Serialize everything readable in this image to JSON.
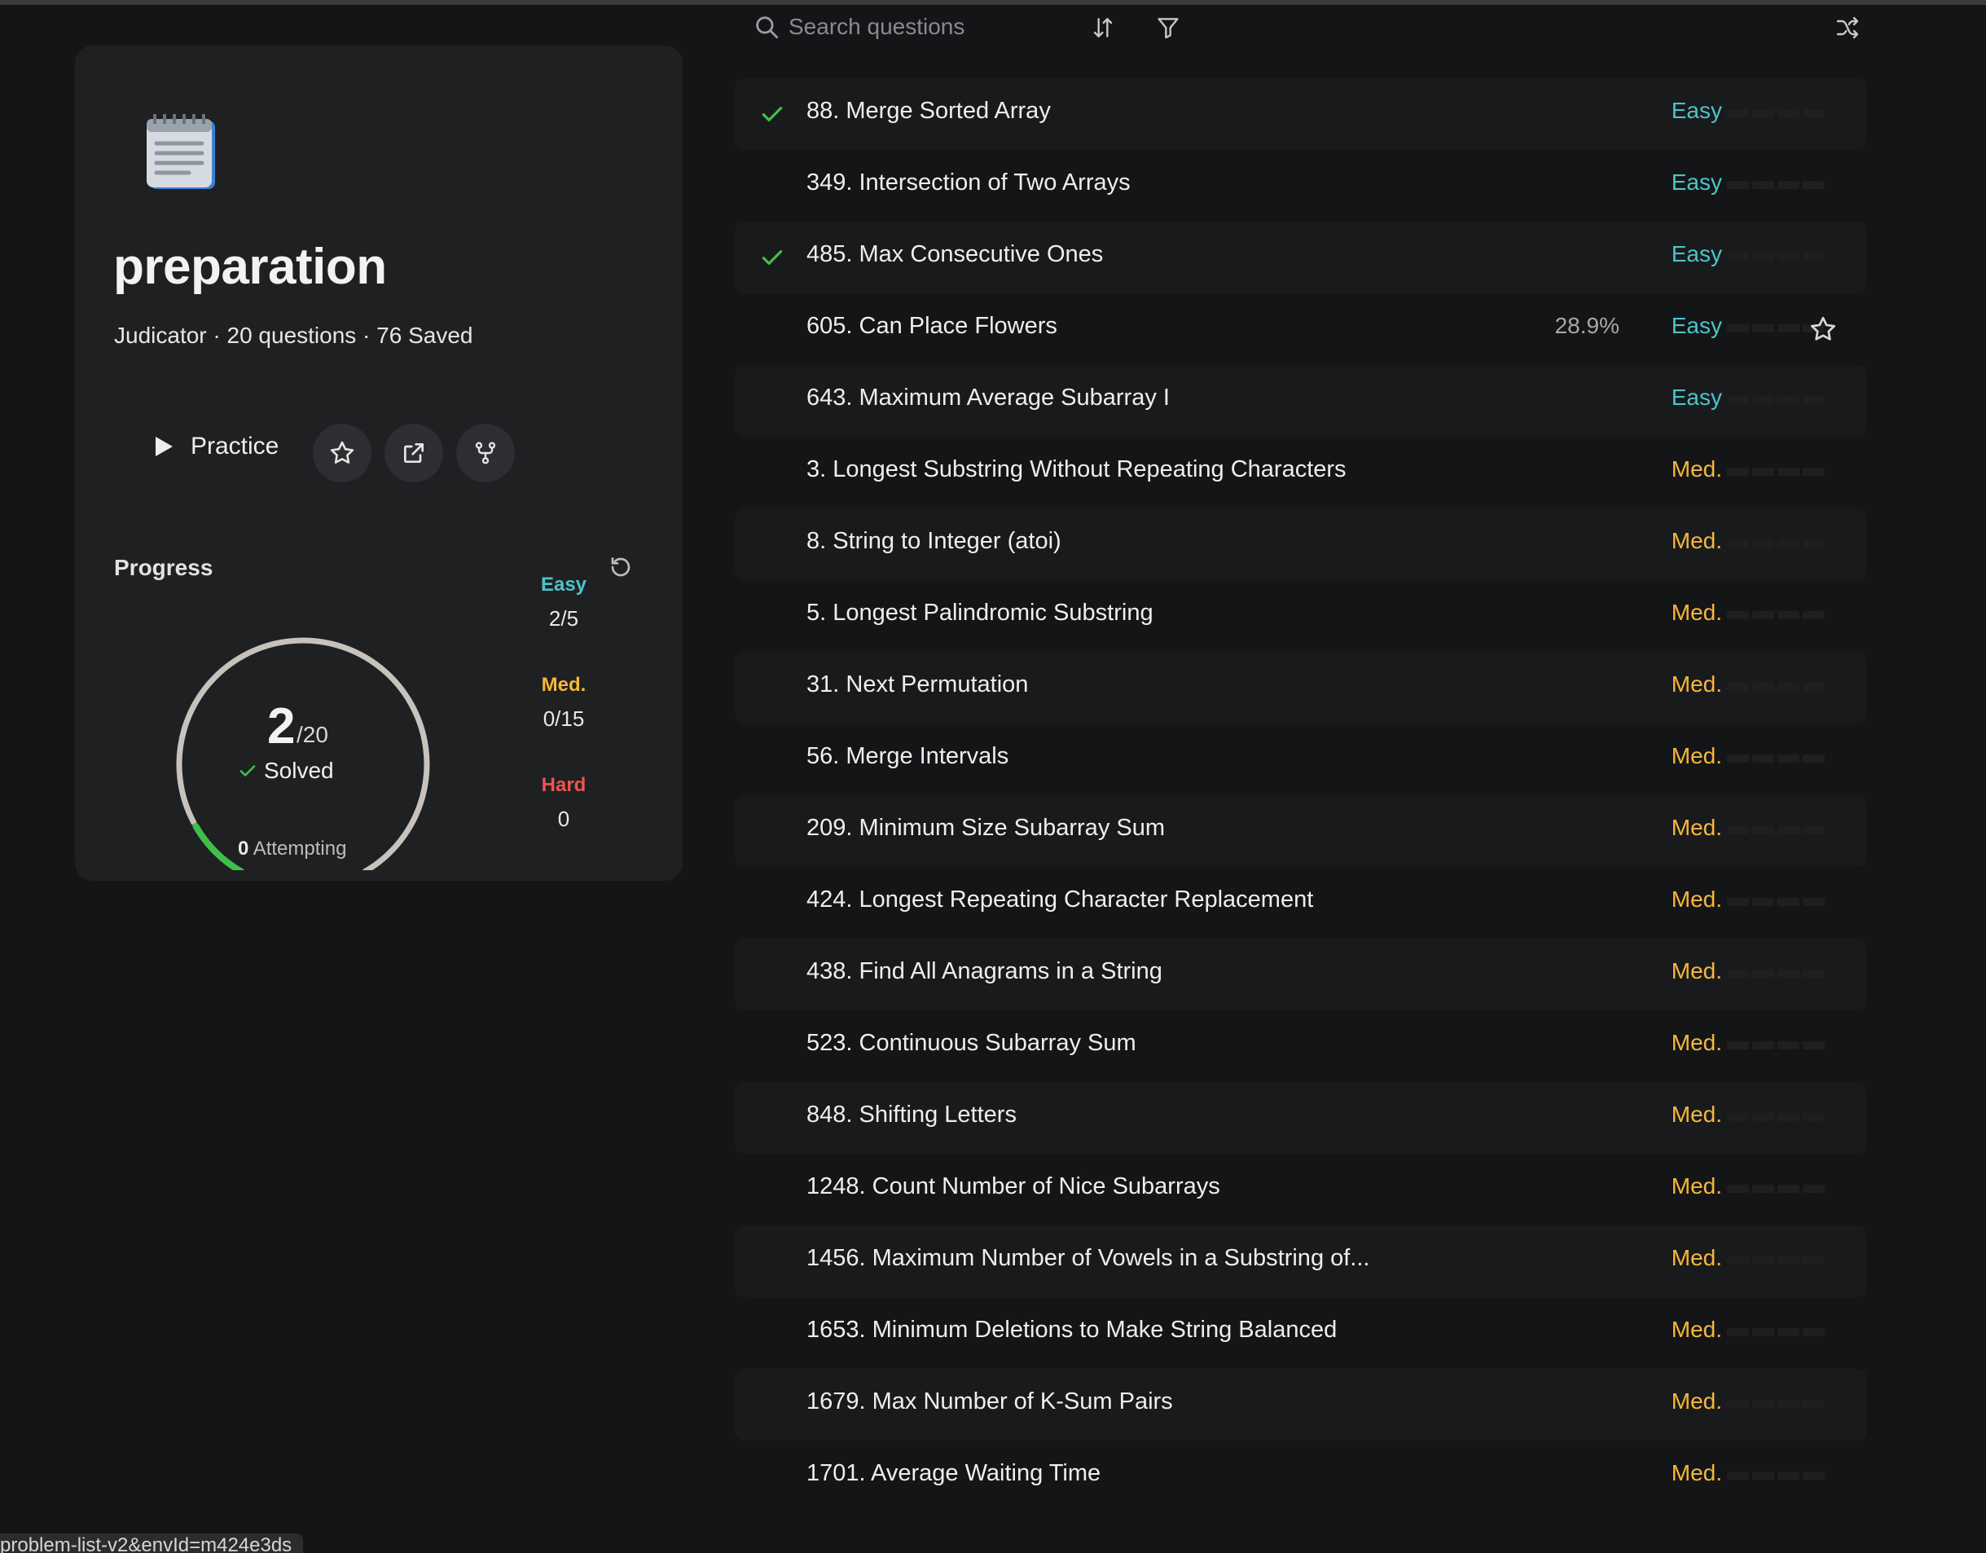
{
  "colors": {
    "easy": "#4dc3c8",
    "medium": "#f5b73b",
    "hard": "#ef5350",
    "solved_check": "#3ec14b",
    "progress_arc": "#3fbf4a"
  },
  "toolbar": {
    "search_placeholder": "Search questions",
    "icons": [
      "search-icon",
      "sort-icon",
      "filter-icon",
      "shuffle-icon"
    ]
  },
  "list_card": {
    "icon": "notepad-icon",
    "title": "preparation",
    "meta": "Judicator · 20 questions · 76 Saved",
    "practice_label": "Practice",
    "action_icons": [
      "star-icon",
      "share-icon",
      "fork-icon"
    ]
  },
  "progress": {
    "label": "Progress",
    "solved": "2",
    "total": "/20",
    "solved_fraction": 0.1,
    "solved_label": "Solved",
    "attempting_count": "0",
    "attempting_label": "Attempting",
    "easy": {
      "label": "Easy",
      "value": "2/5"
    },
    "medium": {
      "label": "Med.",
      "value": "0/15"
    },
    "hard": {
      "label": "Hard",
      "value": "0"
    }
  },
  "questions": [
    {
      "title": "88. Merge Sorted Array",
      "difficulty": "Easy",
      "solved": true,
      "rate": "",
      "starred": false
    },
    {
      "title": "349. Intersection of Two Arrays",
      "difficulty": "Easy",
      "solved": false,
      "rate": "",
      "starred": false
    },
    {
      "title": "485. Max Consecutive Ones",
      "difficulty": "Easy",
      "solved": true,
      "rate": "",
      "starred": false
    },
    {
      "title": "605. Can Place Flowers",
      "difficulty": "Easy",
      "solved": false,
      "rate": "28.9%",
      "starred": true
    },
    {
      "title": "643. Maximum Average Subarray I",
      "difficulty": "Easy",
      "solved": false,
      "rate": "",
      "starred": false
    },
    {
      "title": "3. Longest Substring Without Repeating Characters",
      "difficulty": "Med.",
      "solved": false,
      "rate": "",
      "starred": false
    },
    {
      "title": "8. String to Integer (atoi)",
      "difficulty": "Med.",
      "solved": false,
      "rate": "",
      "starred": false
    },
    {
      "title": "5. Longest Palindromic Substring",
      "difficulty": "Med.",
      "solved": false,
      "rate": "",
      "starred": false
    },
    {
      "title": "31. Next Permutation",
      "difficulty": "Med.",
      "solved": false,
      "rate": "",
      "starred": false
    },
    {
      "title": "56. Merge Intervals",
      "difficulty": "Med.",
      "solved": false,
      "rate": "",
      "starred": false
    },
    {
      "title": "209. Minimum Size Subarray Sum",
      "difficulty": "Med.",
      "solved": false,
      "rate": "",
      "starred": false
    },
    {
      "title": "424. Longest Repeating Character Replacement",
      "difficulty": "Med.",
      "solved": false,
      "rate": "",
      "starred": false
    },
    {
      "title": "438. Find All Anagrams in a String",
      "difficulty": "Med.",
      "solved": false,
      "rate": "",
      "starred": false
    },
    {
      "title": "523. Continuous Subarray Sum",
      "difficulty": "Med.",
      "solved": false,
      "rate": "",
      "starred": false
    },
    {
      "title": "848. Shifting Letters",
      "difficulty": "Med.",
      "solved": false,
      "rate": "",
      "starred": false
    },
    {
      "title": "1248. Count Number of Nice Subarrays",
      "difficulty": "Med.",
      "solved": false,
      "rate": "",
      "starred": false
    },
    {
      "title": "1456. Maximum Number of Vowels in a Substring of...",
      "difficulty": "Med.",
      "solved": false,
      "rate": "",
      "starred": false
    },
    {
      "title": "1653. Minimum Deletions to Make String Balanced",
      "difficulty": "Med.",
      "solved": false,
      "rate": "",
      "starred": false
    },
    {
      "title": "1679. Max Number of K-Sum Pairs",
      "difficulty": "Med.",
      "solved": false,
      "rate": "",
      "starred": false
    },
    {
      "title": "1701. Average Waiting Time",
      "difficulty": "Med.",
      "solved": false,
      "rate": "",
      "starred": false
    }
  ],
  "status_bar": {
    "url": "problem-list-v2&envId=m424e3ds"
  }
}
